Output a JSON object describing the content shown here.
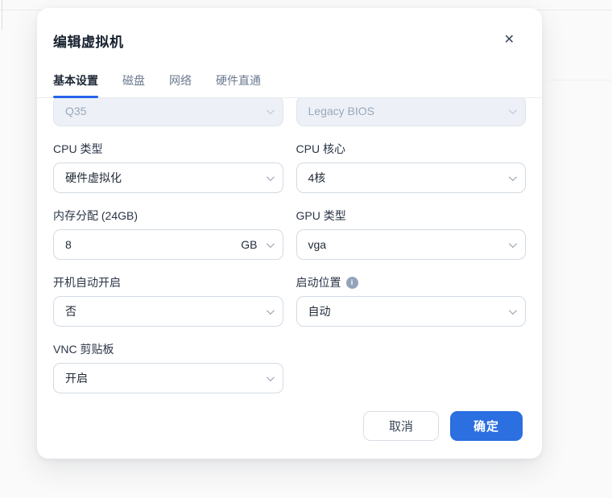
{
  "modal": {
    "title": "编辑虚拟机",
    "icons": {
      "close": "✕",
      "info": "i"
    },
    "tabs": [
      {
        "label": "基本设置",
        "active": true
      },
      {
        "label": "磁盘",
        "active": false
      },
      {
        "label": "网络",
        "active": false
      },
      {
        "label": "硬件直通",
        "active": false
      }
    ],
    "form": {
      "machine_type": {
        "value": "Q35",
        "disabled": true
      },
      "bios": {
        "value": "Legacy BIOS",
        "disabled": true
      },
      "cpu_type": {
        "label": "CPU 类型",
        "value": "硬件虚拟化"
      },
      "cpu_cores": {
        "label": "CPU 核心",
        "value": "4核"
      },
      "memory": {
        "label": "内存分配 (24GB)",
        "value": "8",
        "unit": "GB"
      },
      "gpu_type": {
        "label": "GPU 类型",
        "value": "vga"
      },
      "auto_start": {
        "label": "开机自动开启",
        "value": "否"
      },
      "boot_location": {
        "label": "启动位置",
        "value": "自动"
      },
      "vnc_clipboard": {
        "label": "VNC 剪贴板",
        "value": "开启"
      }
    },
    "footer": {
      "cancel_label": "取消",
      "confirm_label": "确定"
    }
  },
  "colors": {
    "accent_blue": "#2b6fe0",
    "tab_underline": "#2563eb",
    "disabled_field_bg": "#edf1f7",
    "disabled_field_text": "#9aa7ba",
    "modal_bg": "#ffffff",
    "page_bg": "#fafafa"
  }
}
